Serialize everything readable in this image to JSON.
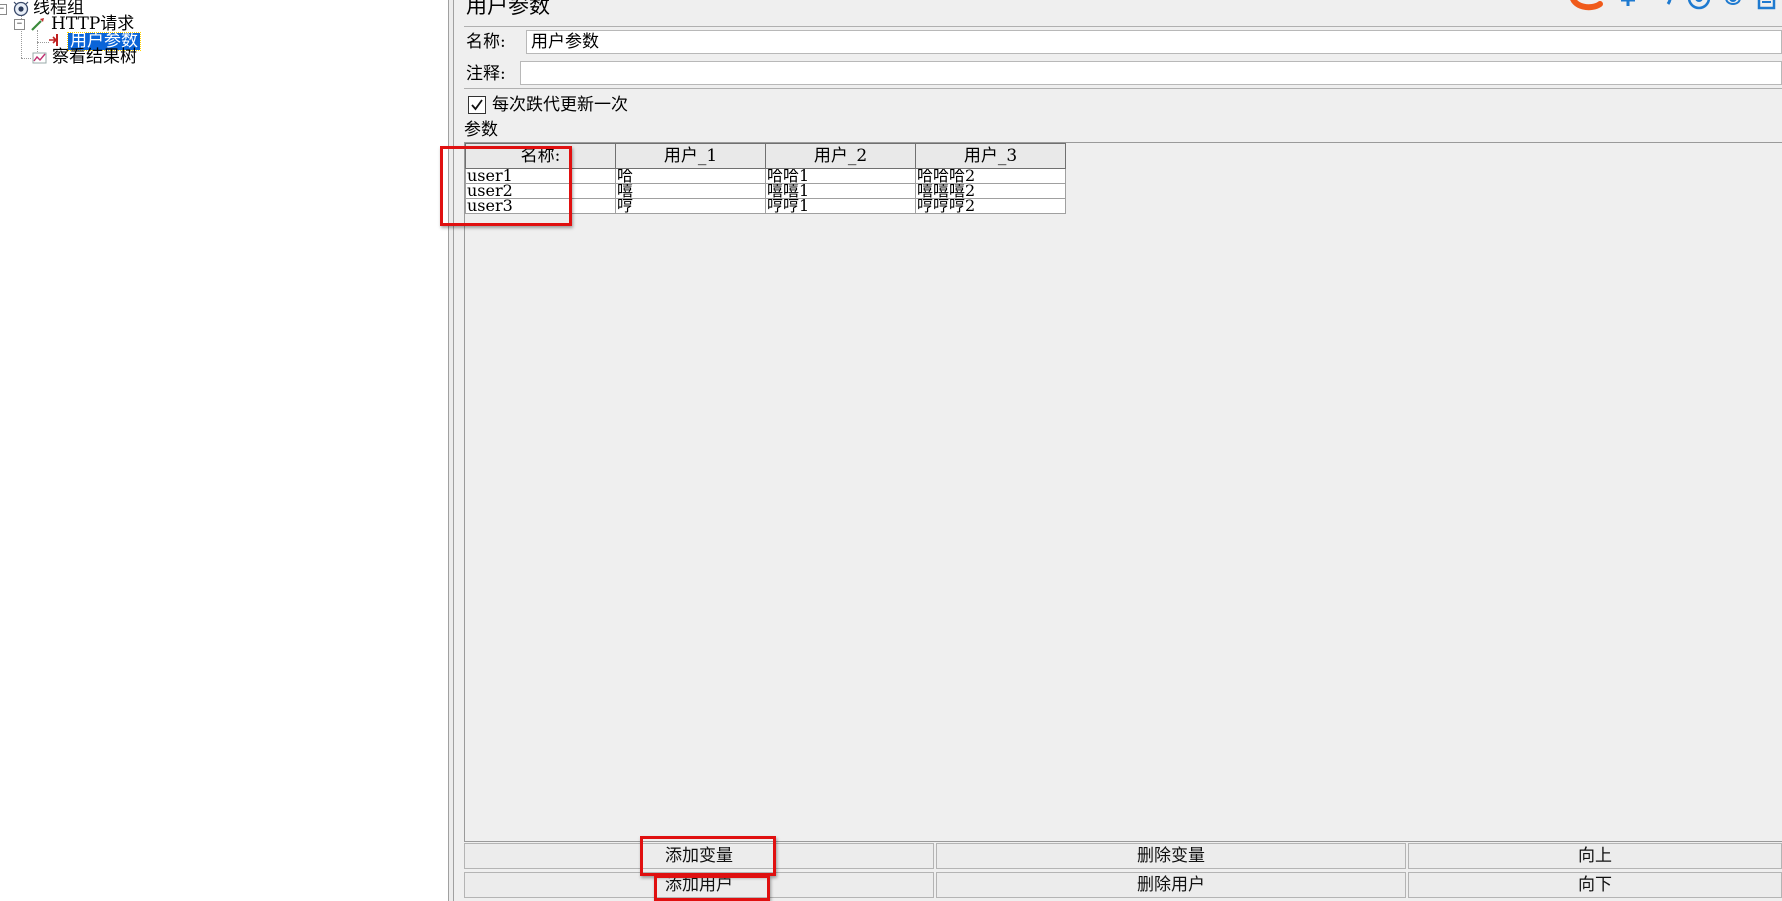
{
  "tree": {
    "thread_group": "线程组",
    "http_request": "HTTP请求",
    "user_params": "用户参数",
    "result_tree": "察看结果树"
  },
  "panel": {
    "title": "用户参数",
    "name_label": "名称:",
    "name_value": "用户参数",
    "comment_label": "注释:",
    "comment_value": "",
    "per_iteration_label": "每次跌代更新一次",
    "per_iteration_checked": true,
    "params_label": "参数"
  },
  "table": {
    "headers": [
      "名称:",
      "用户_1",
      "用户_2",
      "用户_3"
    ],
    "rows": [
      [
        "user1",
        "哈",
        "哈哈1",
        "哈哈哈2"
      ],
      [
        "user2",
        "嘻",
        "嘻嘻1",
        "嘻嘻嘻2"
      ],
      [
        "user3",
        "哼",
        "哼哼1",
        "哼哼哼2"
      ]
    ]
  },
  "buttons": {
    "add_variable": "添加变量",
    "delete_variable": "删除变量",
    "move_up": "向上",
    "add_user": "添加用户",
    "delete_user": "删除用户",
    "move_down": "向下"
  },
  "colors": {
    "selection": "#0a64d8",
    "highlight": "#e01010",
    "panel_bg": "#efefef"
  }
}
